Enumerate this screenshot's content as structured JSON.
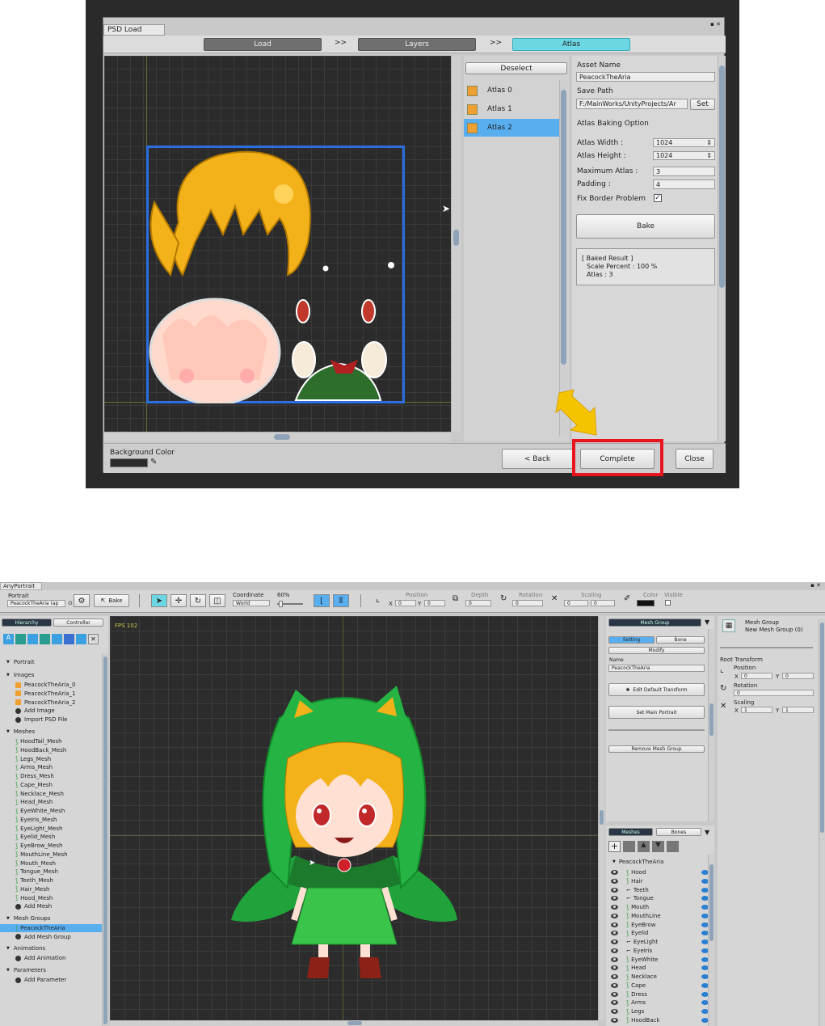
{
  "psd_dialog": {
    "title": "PSD Load",
    "steps": [
      "Load",
      "Layers",
      "Atlas"
    ],
    "step_arrow": ">>",
    "deselect_label": "Deselect",
    "atlases": [
      "Atlas 0",
      "Atlas 1",
      "Atlas 2"
    ],
    "asset_name_label": "Asset Name",
    "asset_name_value": "PeacockTheAria",
    "save_path_label": "Save Path",
    "save_path_value": "F:/MainWorks/UnityProjects/Ar",
    "set_label": "Set",
    "baking_option_label": "Atlas Baking Option",
    "atlas_width_label": "Atlas Width :",
    "atlas_width_value": "1024",
    "atlas_height_label": "Atlas Height :",
    "atlas_height_value": "1024",
    "max_atlas_label": "Maximum Atlas :",
    "max_atlas_value": "3",
    "padding_label": "Padding :",
    "padding_value": "4",
    "fix_border_label": "Fix Border Problem",
    "bake_label": "Bake",
    "result_line1": "[ Baked Result ]",
    "result_line2": "Scale Percent : 100 %",
    "result_line3": "Atlas : 3",
    "bg_color_label": "Background Color",
    "back_label": "< Back",
    "complete_label": "Complete",
    "close_label": "Close"
  },
  "editor": {
    "window_title": "AnyPortrait",
    "portrait_label": "Portrait",
    "portrait_value": "PeacockTheAria (ap",
    "bake_label": "Bake",
    "coordinate_label": "Coordinate",
    "coordinate_value": "World",
    "zoom_value": "60%",
    "position_label": "Position",
    "depth_label": "Depth",
    "rotation_label": "Rotation",
    "scaling_label": "Scaling",
    "color_label": "Color",
    "visible_label": "Visible",
    "x_label": "X",
    "y_label": "Y",
    "zero": "0",
    "fps_label": "FPS 102",
    "tabs": [
      "Hierarchy",
      "Controller"
    ],
    "portrait_section": "Portrait",
    "images_section": "Images",
    "images": [
      "PeacockTheAria_0",
      "PeacockTheAria_1",
      "PeacockTheAria_2",
      "Add Image",
      "Import PSD File"
    ],
    "meshes_section": "Meshes",
    "meshes": [
      "HoodTail_Mesh",
      "HoodBack_Mesh",
      "Legs_Mesh",
      "Arms_Mesh",
      "Dress_Mesh",
      "Cape_Mesh",
      "Necklace_Mesh",
      "Head_Mesh",
      "EyeWhite_Mesh",
      "EyeIris_Mesh",
      "EyeLight_Mesh",
      "Eyelid_Mesh",
      "EyeBrow_Mesh",
      "MouthLine_Mesh",
      "Mouth_Mesh",
      "Tongue_Mesh",
      "Teeth_Mesh",
      "Hair_Mesh",
      "Hood_Mesh",
      "Add Mesh"
    ],
    "mesh_groups_section": "Mesh Groups",
    "mesh_groups": [
      "PeacockTheAria",
      "Add Mesh Group"
    ],
    "animations_section": "Animations",
    "animations": [
      "Add Animation"
    ],
    "parameters_section": "Parameters",
    "parameters": [
      "Add Parameter"
    ],
    "mesh_group_header": "Mesh Group",
    "setting_tab": "Setting",
    "bone_tab": "Bone",
    "modify_label": "Modify",
    "name_label": "Name",
    "name_value": "PeacockTheAria",
    "edit_default_transform": "Edit Default Transform",
    "set_main_portrait": "Set Main Portrait",
    "remove_mesh_group": "Remove Mesh Group",
    "meshes_tab": "Meshes",
    "bones_tab": "Bones",
    "tree_root": "PeacockTheAria",
    "tree_items": [
      "Hood",
      "Hair",
      "Teeth",
      "Tongue",
      "Mouth",
      "MouthLine",
      "EyeBrow",
      "Eyelid",
      "EyeLight",
      "EyeIris",
      "EyeWhite",
      "Head",
      "Necklace",
      "Cape",
      "Dress",
      "Arms",
      "Legs",
      "HoodBack"
    ],
    "inspector_title": "Mesh Group",
    "inspector_subtitle": "New Mesh Group (0)",
    "root_transform": "Root Transform",
    "rotation_value": "0",
    "scale_value": "1"
  },
  "colors": {
    "accent": "#6cd6e3",
    "selection": "#59aef0",
    "highlight_red": "#e8141e",
    "arrow_yellow": "#f5c400"
  }
}
